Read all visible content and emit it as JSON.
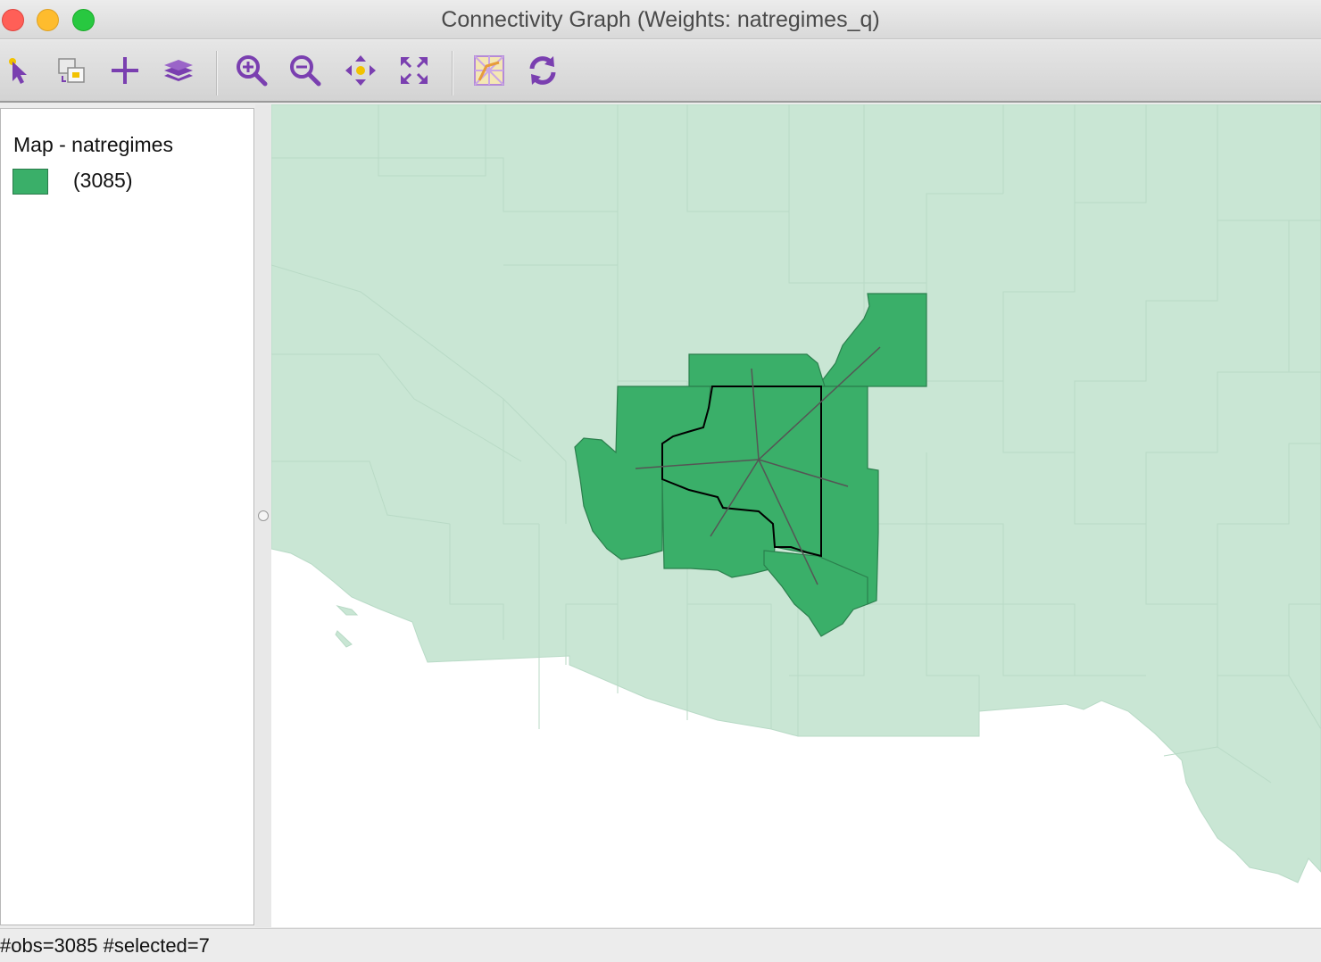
{
  "window": {
    "title": "Connectivity Graph (Weights: natregimes_q)"
  },
  "toolbar": {
    "tools": [
      {
        "name": "select-tool",
        "icon": "pointer-icon"
      },
      {
        "name": "copy-image-tool",
        "icon": "copy-image-icon"
      },
      {
        "name": "add-tool",
        "icon": "plus-icon"
      },
      {
        "name": "layers-tool",
        "icon": "layers-icon"
      },
      {
        "name": "zoom-in-tool",
        "icon": "zoom-in-icon"
      },
      {
        "name": "zoom-out-tool",
        "icon": "zoom-out-icon"
      },
      {
        "name": "pan-tool",
        "icon": "pan-icon"
      },
      {
        "name": "full-extent-tool",
        "icon": "full-extent-icon"
      },
      {
        "name": "basemap-tool",
        "icon": "basemap-icon"
      },
      {
        "name": "refresh-tool",
        "icon": "refresh-icon"
      }
    ],
    "icon_color": "#7a3fb0"
  },
  "legend": {
    "title": "Map - natregimes",
    "items": [
      {
        "label": "(3085)",
        "color": "#3aaf69"
      }
    ]
  },
  "map": {
    "base_fill": "#c9e6d4",
    "base_stroke": "#b3d6c1",
    "selected_fill": "#3aaf69",
    "selected_stroke": "#2b7f4d",
    "graph_edge_color": "#555555",
    "focus_outline_color": "#000000"
  },
  "status": {
    "text": "#obs=3085 #selected=7"
  }
}
